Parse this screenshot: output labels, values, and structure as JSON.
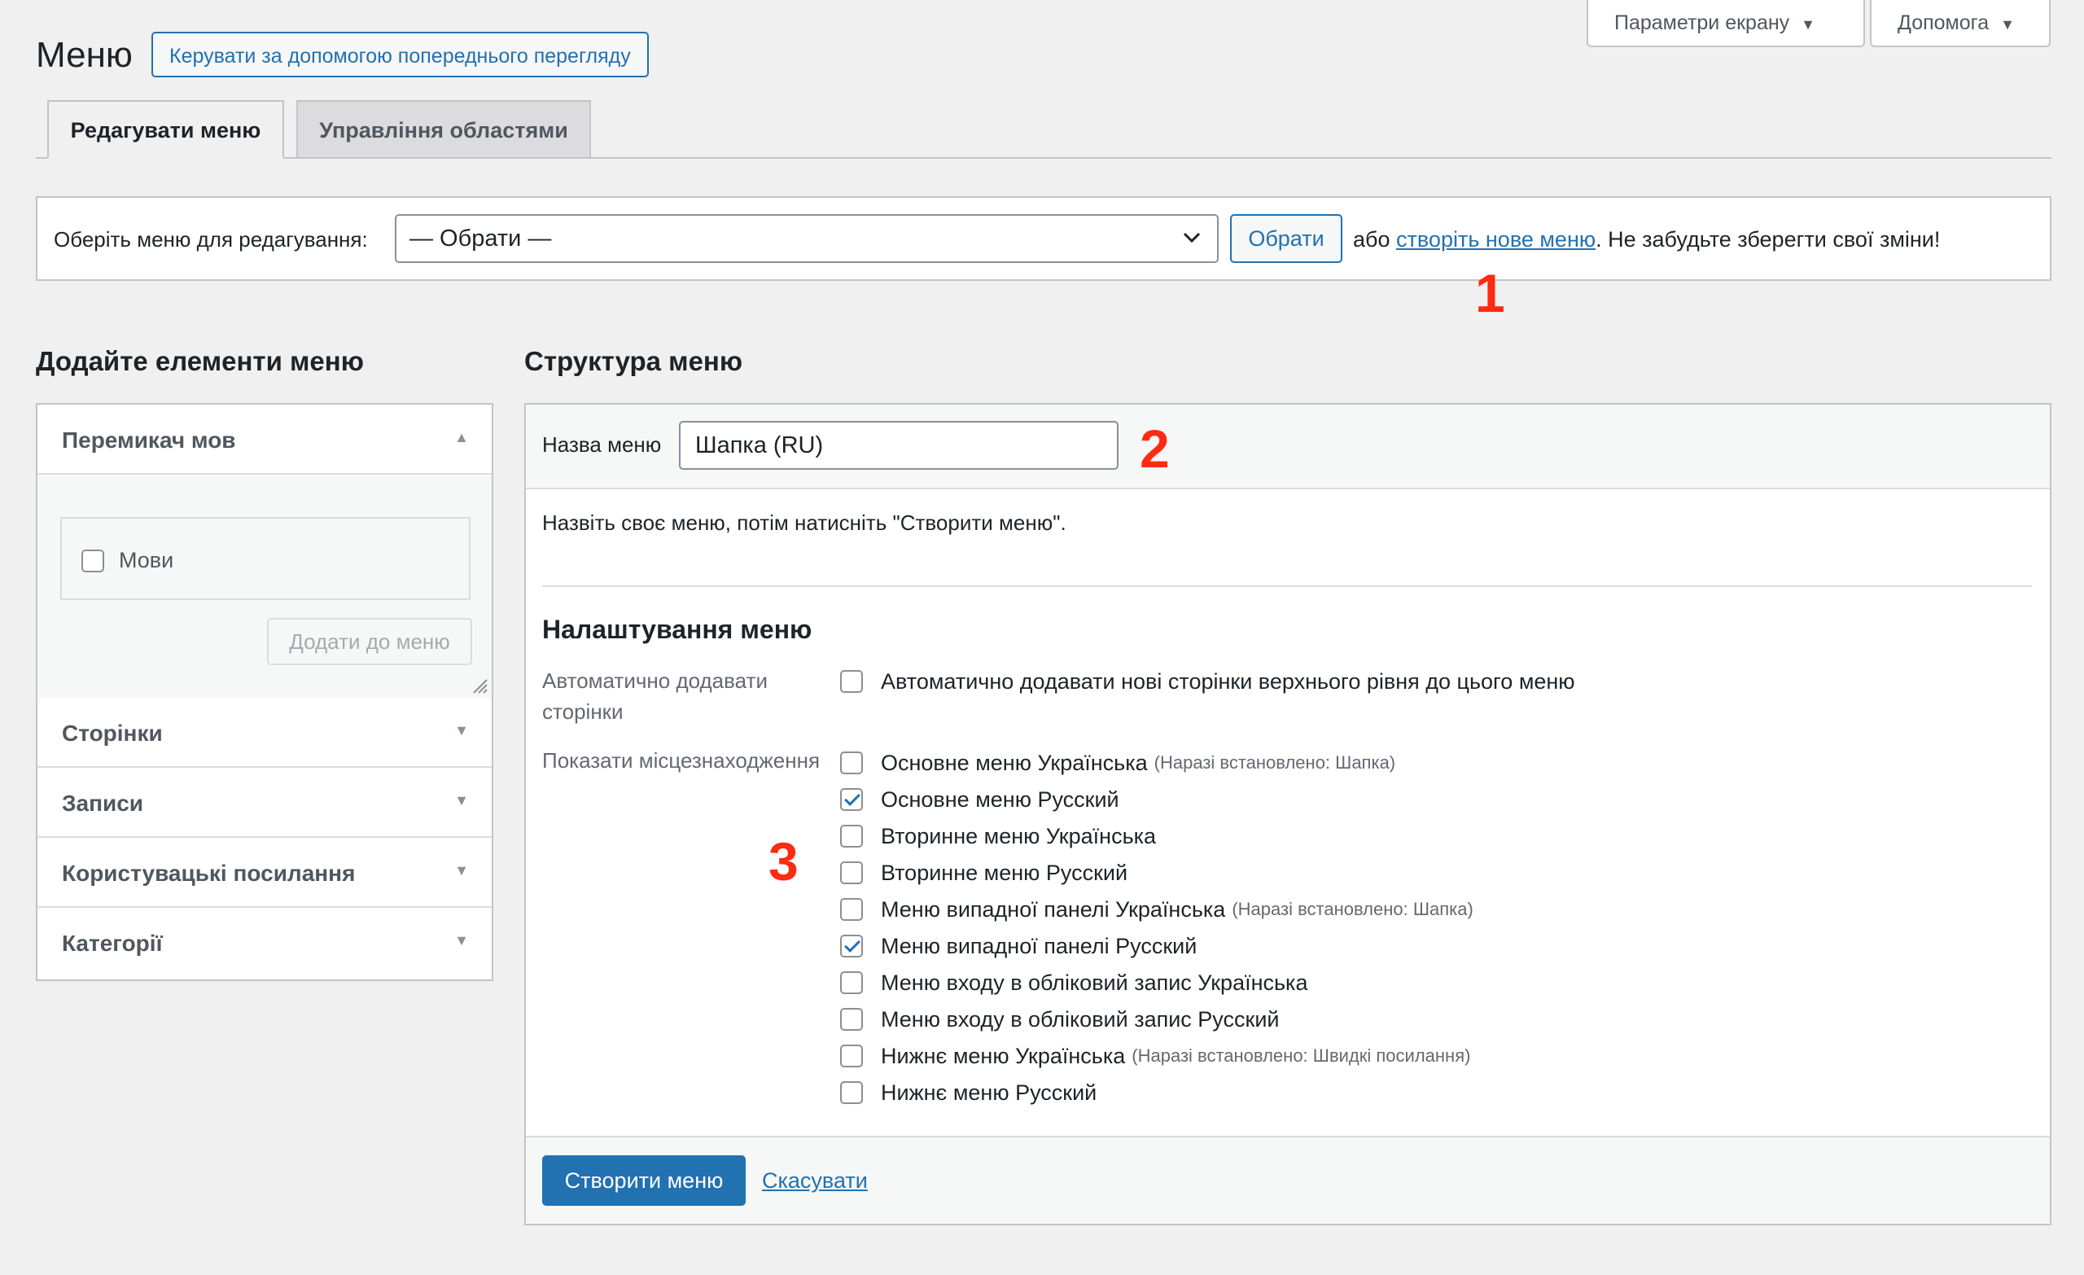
{
  "header": {
    "title": "Меню",
    "preview_button": "Керувати за допомогою попереднього перегляду",
    "screen_options": "Параметри екрану",
    "help": "Допомога"
  },
  "tabs": [
    {
      "label": "Редагувати меню",
      "active": true
    },
    {
      "label": "Управління областями",
      "active": false
    }
  ],
  "select_bar": {
    "label": "Оберіть меню для редагування:",
    "select_value": "— Обрати —",
    "choose_button": "Обрати",
    "or_text": "або",
    "create_link": "створіть нове меню",
    "reminder": ". Не забудьте зберегти свої зміни!"
  },
  "annotations": {
    "one": "1",
    "two": "2",
    "three": "3"
  },
  "left": {
    "title": "Додайте елементи меню",
    "accordion": [
      {
        "label": "Перемикач мов",
        "open": true
      },
      {
        "label": "Сторінки",
        "open": false
      },
      {
        "label": "Записи",
        "open": false
      },
      {
        "label": "Користувацькі посилання",
        "open": false
      },
      {
        "label": "Категорії",
        "open": false
      }
    ],
    "languages_checkbox": "Мови",
    "add_button": "Додати до меню"
  },
  "right": {
    "title": "Структура меню",
    "name_label": "Назва меню",
    "name_value": "Шапка (RU)",
    "instruction": "Назвіть своє меню, потім натисніть \"Створити меню\".",
    "settings_title": "Налаштування меню",
    "auto_add_label": "Автоматично додавати сторінки",
    "auto_add_option": "Автоматично додавати нові сторінки верхнього рівня до цього меню",
    "locations_label": "Показати місцезнаходження",
    "locations": [
      {
        "label": "Основне меню Українська",
        "note": "(Наразі встановлено: Шапка)",
        "checked": false
      },
      {
        "label": "Основне меню Русский",
        "note": "",
        "checked": true
      },
      {
        "label": "Вторинне меню Українська",
        "note": "",
        "checked": false
      },
      {
        "label": "Вторинне меню Русский",
        "note": "",
        "checked": false
      },
      {
        "label": "Меню випадної панелі Українська",
        "note": "(Наразі встановлено: Шапка)",
        "checked": false
      },
      {
        "label": "Меню випадної панелі Русский",
        "note": "",
        "checked": true
      },
      {
        "label": "Меню входу в обліковий запис Українська",
        "note": "",
        "checked": false
      },
      {
        "label": "Меню входу в обліковий запис Русский",
        "note": "",
        "checked": false
      },
      {
        "label": "Нижнє меню Українська",
        "note": "(Наразі встановлено: Швидкі посилання)",
        "checked": false
      },
      {
        "label": "Нижнє меню Русский",
        "note": "",
        "checked": false
      }
    ],
    "create_button": "Створити меню",
    "cancel_link": "Скасувати"
  },
  "colors": {
    "accent": "#2271b1",
    "annotation": "#ff2a12",
    "background": "#f0f0f1"
  }
}
